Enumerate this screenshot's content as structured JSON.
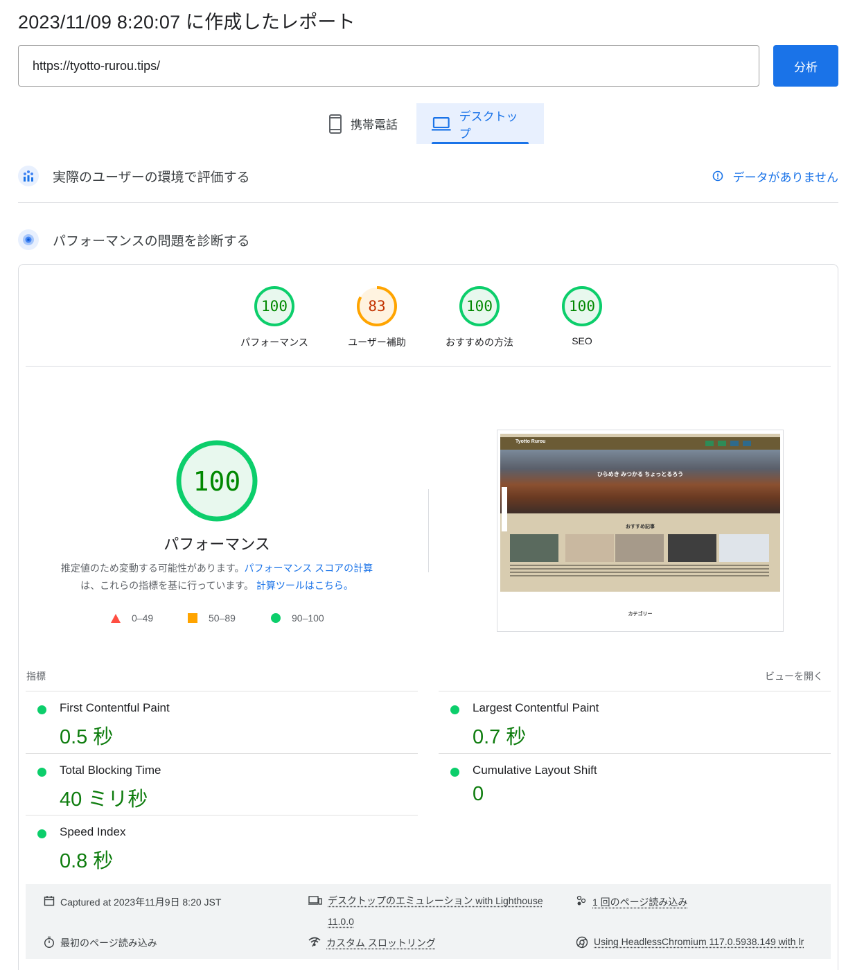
{
  "header": {
    "title": "2023/11/09 8:20:07 に作成したレポート"
  },
  "url_input": {
    "value": "https://tyotto-rurou.tips/"
  },
  "analyze_button": {
    "label": "分析"
  },
  "device_tabs": [
    {
      "label": "携帯電話",
      "icon": "mobile-phone-icon",
      "active": false
    },
    {
      "label": "デスクトップ",
      "icon": "laptop-icon",
      "active": true
    }
  ],
  "field_data": {
    "title": "実際のユーザーの環境で評価する",
    "status": "データがありません"
  },
  "diagnose": {
    "title": "パフォーマンスの問題を診断する"
  },
  "categories": [
    {
      "label": "パフォーマンス",
      "score": "100",
      "score_value": 100,
      "color": "#0cce6b"
    },
    {
      "label": "ユーザー補助",
      "score": "83",
      "score_value": 83,
      "color": "#ffa400"
    },
    {
      "label": "おすすめの方法",
      "score": "100",
      "score_value": 100,
      "color": "#0cce6b"
    },
    {
      "label": "SEO",
      "score": "100",
      "score_value": 100,
      "color": "#0cce6b"
    }
  ],
  "performance": {
    "score": "100",
    "score_value": 100,
    "label": "パフォーマンス",
    "desc_text_1": "推定値のため変動する可能性があります。",
    "desc_link_1": "パフォーマンス スコアの計算",
    "desc_text_2": "は、これらの指標を基に行っています。",
    "desc_link_2": "計算ツールはこちら。"
  },
  "legend": [
    {
      "range": "0–49",
      "shape": "triangle",
      "color": "#ff4e42"
    },
    {
      "range": "50–89",
      "shape": "square",
      "color": "#ffa400"
    },
    {
      "range": "90–100",
      "shape": "circle",
      "color": "#0cce6b"
    }
  ],
  "screenshot": {
    "site_title": "Tyotto Rurou",
    "hero_text": "ひらめき みつかる ちょっとるろう",
    "section_heading": "おすすめ記事",
    "category_heading": "カテゴリー"
  },
  "metrics": {
    "header": "指標",
    "expand_link": "ビューを開く",
    "items": [
      {
        "name": "First Contentful Paint",
        "value": "0.5 秒"
      },
      {
        "name": "Largest Contentful Paint",
        "value": "0.7 秒"
      },
      {
        "name": "Total Blocking Time",
        "value": "40 ミリ秒"
      },
      {
        "name": "Cumulative Layout Shift",
        "value": "0"
      },
      {
        "name": "Speed Index",
        "value": "0.8 秒"
      }
    ]
  },
  "footer": {
    "captured": "Captured at 2023年11月9日 8:20 JST",
    "emulation_line1": "デスクトップのエミュレーション with Lighthouse",
    "emulation_line2": "11.0.0",
    "page_loads": "1 回のページ読み込み",
    "first_load": "最初のページ読み込み",
    "throttling": "カスタム スロットリング",
    "browser": "Using HeadlessChromium 117.0.5938.149 with lr"
  }
}
